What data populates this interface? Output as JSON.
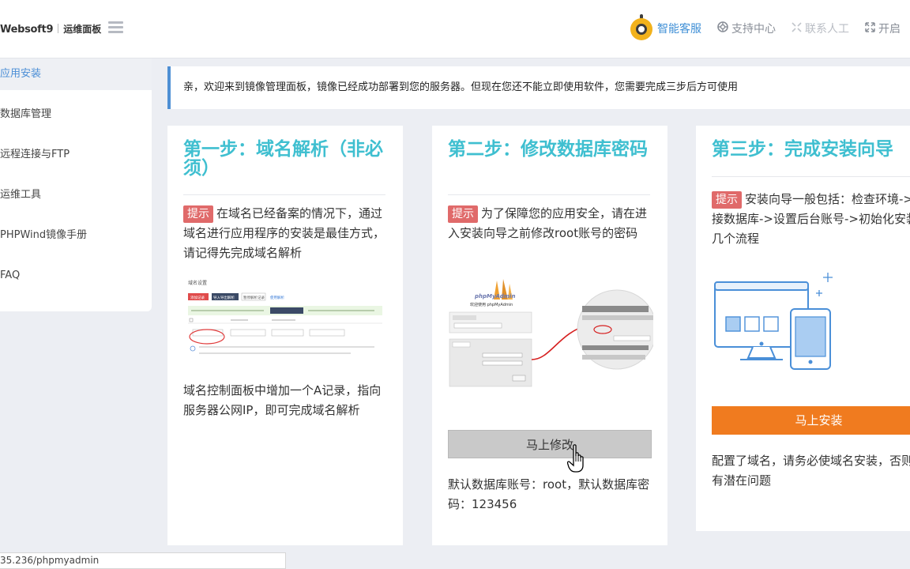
{
  "header": {
    "logo_brand": "Websoft9",
    "logo_sub": "运维面板",
    "nav": {
      "smart_service": "智能客服",
      "support_center": "支持中心",
      "contact_human": "联系人工",
      "open": "开启"
    }
  },
  "sidebar": {
    "items": [
      {
        "label": "应用安装",
        "active": true
      },
      {
        "label": "数据库管理"
      },
      {
        "label": "远程连接与FTP"
      },
      {
        "label": "运维工具"
      },
      {
        "label": "PHPWind镜像手册"
      },
      {
        "label": "FAQ"
      }
    ]
  },
  "notice": {
    "text": "亲，欢迎来到镜像管理面板，镜像已经成功部署到您的服务器。但现在您还不能立即使用软件，您需要完成三步后方可使用"
  },
  "cards": [
    {
      "title": "第一步：域名解析（非必须）",
      "tip_label": "提示",
      "tip_text": "在域名已经备案的情况下，通过域名进行应用程序的安装是最佳方式，请记得先完成域名解析",
      "image_labels": {
        "heading": "域名设置",
        "buttons": [
          "添加记录",
          "导入导出解析",
          "暂停解析记录",
          "使用解析"
        ]
      },
      "footer_text": "域名控制面板中增加一个A记录，指向服务器公网IP，即可完成域名解析"
    },
    {
      "title": "第二步：修改数据库密码",
      "tip_label": "提示",
      "tip_text": "为了保障您的应用安全，请在进入安装向导之前修改root账号的密码",
      "image_labels": {
        "logo": "phpMyAdmin",
        "welcome": "欢迎使用 phpMyAdmin"
      },
      "button_label": "马上修改",
      "footer_text": "默认数据库账号：root，默认数据库密码：123456"
    },
    {
      "title": "第三步：完成安装向导",
      "tip_label": "提示",
      "tip_text": "安装向导一般包括：检查环境->连接数据库->设置后台账号->初始化安装几个流程",
      "button_label": "马上安装",
      "footer_text": "配置了域名，请务必使域名安装，否则会有潜在问题"
    }
  ],
  "statusbar": {
    "url": "35.236/phpmyadmin"
  },
  "colors": {
    "title": "#3fbfd0",
    "accent_blue": "#4e8fd4",
    "tip_red": "#e06a6a",
    "install_orange": "#f07b1f"
  }
}
